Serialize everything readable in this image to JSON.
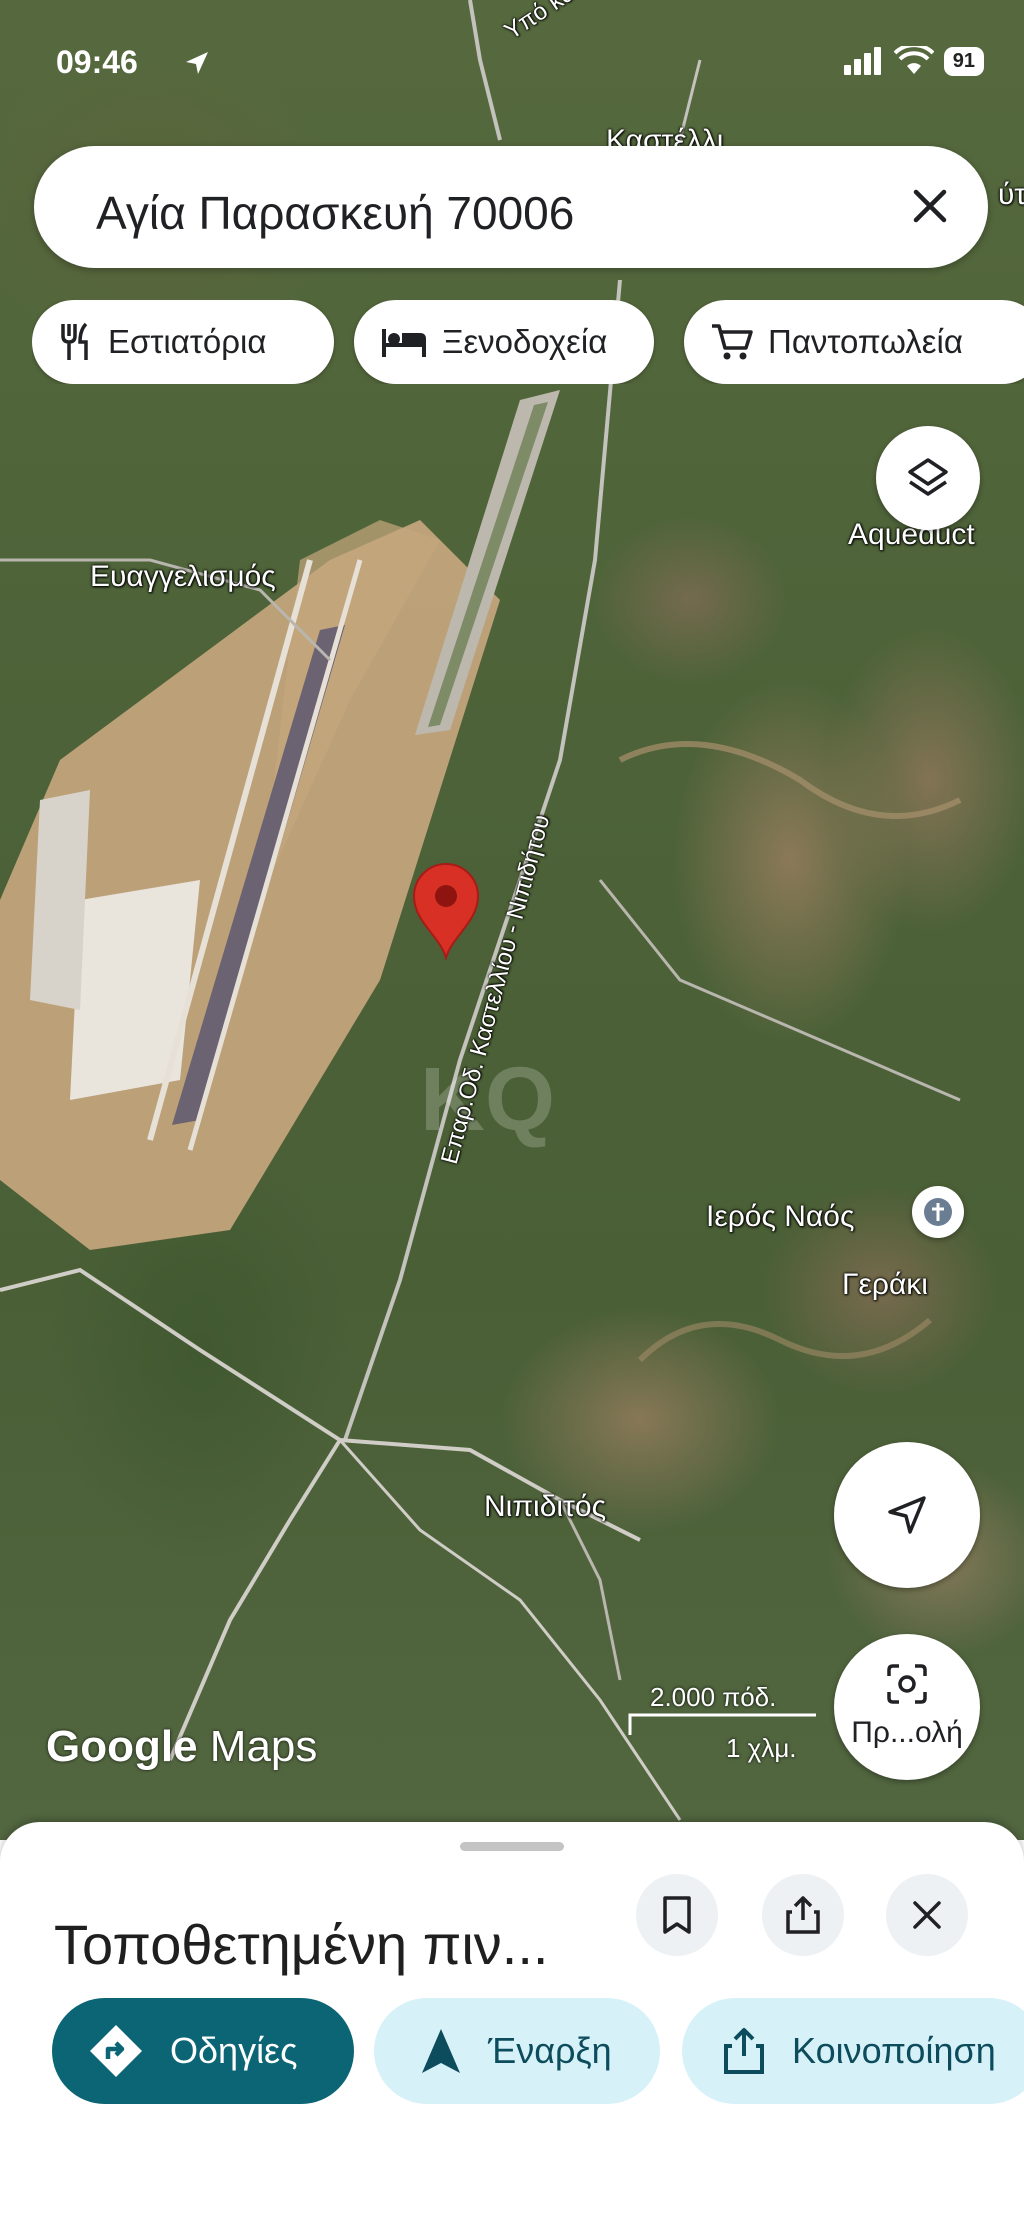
{
  "status_bar": {
    "time": "09:46",
    "battery": "91"
  },
  "search": {
    "query": "Αγία Παρασκευή 70006"
  },
  "chips": [
    {
      "label": "Εστιατόρια",
      "icon": "restaurant-icon"
    },
    {
      "label": "Ξενοδοχεία",
      "icon": "hotel-icon"
    },
    {
      "label": "Παντοπωλεία",
      "icon": "cart-icon"
    }
  ],
  "map": {
    "labels": {
      "evangelismos": "Ευαγγελισμός",
      "aqueduct": "Aqueduct",
      "road": "Επαρ.Οδ. Καστελλίου - Νιπιδήτου",
      "church": "Ιερός Ναός",
      "geraki": "Γεράκι",
      "nipiditos": "Νιπιδιτός",
      "top_road": "Υπό κατ",
      "top_place": "Καστέλλι",
      "edge_right": "ύτ"
    },
    "scale": {
      "feet": "2.000 πόδ.",
      "km": "1 χλμ."
    },
    "brand": {
      "google": "Google",
      "maps": "Maps"
    },
    "layers_icon": "layers-icon",
    "location_icon": "navigation-arrow-icon",
    "lens": {
      "icon": "lens-camera-icon",
      "label": "Πρ...ολή"
    }
  },
  "sheet": {
    "title": "Τοποθετημένη πιν...",
    "actions": [
      {
        "label": "Οδηγίες",
        "icon": "directions-icon"
      },
      {
        "label": "Έναρξη",
        "icon": "navigation-icon"
      },
      {
        "label": "Κοινοποίηση",
        "icon": "share-icon"
      }
    ]
  },
  "colors": {
    "accent": "#0b6575",
    "secondary_bg": "#d6f2f8",
    "pin": "#d93025"
  }
}
